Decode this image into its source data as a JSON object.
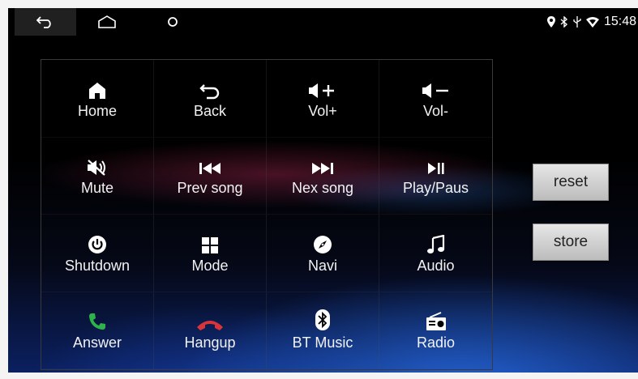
{
  "statusbar": {
    "time": "15:48",
    "icons": [
      "location-pin-icon",
      "bluetooth-icon",
      "usb-icon",
      "wifi-icon"
    ]
  },
  "navbar": {
    "icons": [
      "back-arrow-icon",
      "home-outline-icon",
      "recent-circle-icon"
    ]
  },
  "grid": {
    "keys": [
      {
        "label": "Home",
        "icon": "home-icon"
      },
      {
        "label": "Back",
        "icon": "back-icon"
      },
      {
        "label": "Vol+",
        "icon": "volume-up-icon"
      },
      {
        "label": "Vol-",
        "icon": "volume-down-icon"
      },
      {
        "label": "Mute",
        "icon": "mute-icon"
      },
      {
        "label": "Prev song",
        "icon": "previous-track-icon"
      },
      {
        "label": "Nex song",
        "icon": "next-track-icon"
      },
      {
        "label": "Play/Paus",
        "icon": "play-pause-icon"
      },
      {
        "label": "Shutdown",
        "icon": "power-icon"
      },
      {
        "label": "Mode",
        "icon": "mode-grid-icon"
      },
      {
        "label": "Navi",
        "icon": "compass-icon"
      },
      {
        "label": "Audio",
        "icon": "music-note-icon"
      },
      {
        "label": "Answer",
        "icon": "answer-phone-icon"
      },
      {
        "label": "Hangup",
        "icon": "hangup-phone-icon"
      },
      {
        "label": "BT Music",
        "icon": "bluetooth-music-icon"
      },
      {
        "label": "Radio",
        "icon": "radio-icon"
      }
    ]
  },
  "buttons": {
    "reset": "reset",
    "store": "store"
  },
  "colors": {
    "answer": "#2db34a",
    "hangup": "#d9343a"
  }
}
